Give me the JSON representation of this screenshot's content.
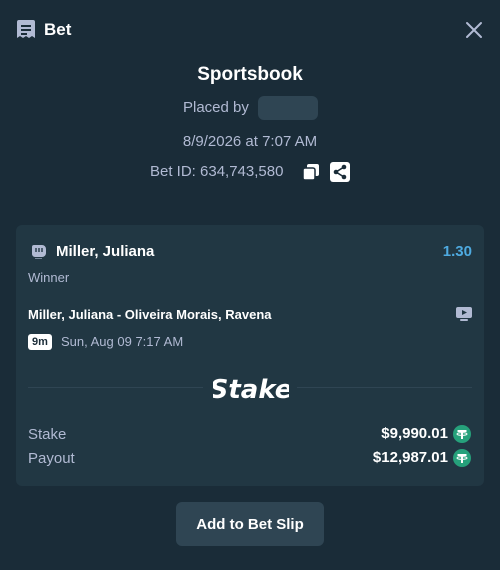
{
  "header": {
    "title": "Bet",
    "icon": "receipt-icon"
  },
  "colors": {
    "background": "#1a2c38",
    "card": "#213743",
    "muted": "#b1bad3",
    "accent": "#4eaae0",
    "tether": "#26a17b"
  },
  "bet": {
    "book": "Sportsbook",
    "placed_by_label": "Placed by",
    "datetime": "8/9/2026 at 7:07 AM",
    "bet_id": "Bet ID: 634,743,580"
  },
  "selection": {
    "player": "Miller, Juliana",
    "odds": "1.30",
    "market": "Winner",
    "matchup": "Miller, Juliana - Oliveira Morais, Ravena",
    "badge": "9m",
    "start": "Sun, Aug 09  7:17 AM",
    "brand": "Stake"
  },
  "totals": {
    "stake_label": "Stake",
    "stake_value": "$9,990.01",
    "payout_label": "Payout",
    "payout_value": "$12,987.01"
  },
  "actions": {
    "add_to_slip": "Add to Bet Slip"
  }
}
